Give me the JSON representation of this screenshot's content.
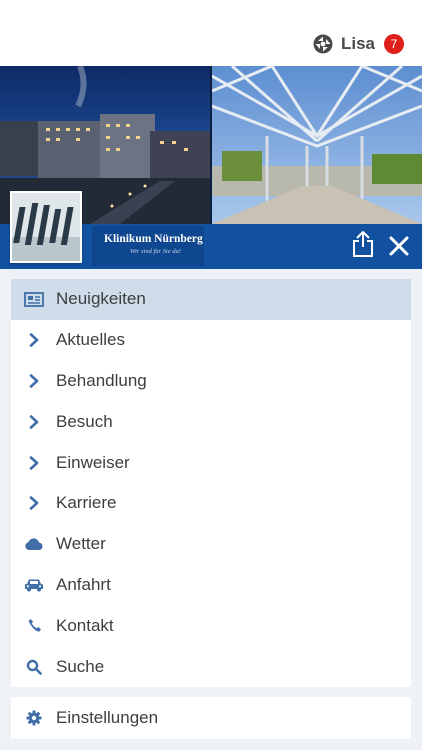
{
  "user": {
    "name": "Lisa",
    "badge_count": "7",
    "logo_icon": "app-logo-icon"
  },
  "brand": {
    "name": "Klinikum Nürnberg",
    "slogan": "Wir sind für Sie da!"
  },
  "header_actions": {
    "share_icon": "share-icon",
    "close_icon": "close-icon"
  },
  "menu": {
    "items": [
      {
        "label": "Neuigkeiten",
        "icon": "newspaper-icon",
        "active": true
      },
      {
        "label": "Aktuelles",
        "icon": "chevron-right-icon"
      },
      {
        "label": "Behandlung",
        "icon": "chevron-right-icon"
      },
      {
        "label": "Besuch",
        "icon": "chevron-right-icon"
      },
      {
        "label": "Einweiser",
        "icon": "chevron-right-icon"
      },
      {
        "label": "Karriere",
        "icon": "chevron-right-icon"
      },
      {
        "label": "Wetter",
        "icon": "cloud-icon"
      },
      {
        "label": "Anfahrt",
        "icon": "car-icon"
      },
      {
        "label": "Kontakt",
        "icon": "phone-icon"
      },
      {
        "label": "Suche",
        "icon": "search-icon"
      }
    ],
    "settings": {
      "label": "Einstellungen",
      "icon": "gear-icon"
    }
  },
  "colors": {
    "brand_blue": "#1250a0",
    "icon_blue": "#3f6ea8",
    "active_row": "#cfdcea",
    "badge_red": "#e0201b"
  }
}
